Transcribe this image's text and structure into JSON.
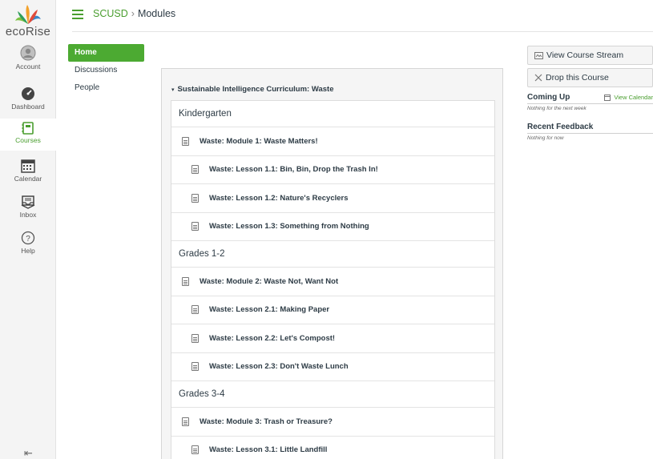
{
  "brand": {
    "logo_text": "ecoRise",
    "accent": "#4caa32"
  },
  "global_nav": [
    {
      "label": "Account",
      "icon": "account-icon"
    },
    {
      "label": "Dashboard",
      "icon": "dashboard-icon"
    },
    {
      "label": "Courses",
      "icon": "courses-icon",
      "active": true
    },
    {
      "label": "Calendar",
      "icon": "calendar-icon"
    },
    {
      "label": "Inbox",
      "icon": "inbox-icon"
    },
    {
      "label": "Help",
      "icon": "help-icon"
    }
  ],
  "collapse_icon": "⇤",
  "breadcrumb": {
    "course": "SCUSD",
    "separator": "›",
    "page": "Modules"
  },
  "course_nav": [
    {
      "label": "Home",
      "active": true
    },
    {
      "label": "Discussions"
    },
    {
      "label": "People"
    }
  ],
  "module": {
    "caret": "▾",
    "title": "Sustainable Intelligence Curriculum: Waste",
    "rows": [
      {
        "type": "header",
        "text": "Kindergarten"
      },
      {
        "type": "item",
        "level": 0,
        "text": "Waste: Module 1: Waste Matters!"
      },
      {
        "type": "item",
        "level": 1,
        "text": "Waste: Lesson 1.1: Bin, Bin, Drop the Trash In!"
      },
      {
        "type": "item",
        "level": 1,
        "text": "Waste: Lesson 1.2: Nature's Recyclers"
      },
      {
        "type": "item",
        "level": 1,
        "text": "Waste: Lesson 1.3: Something from Nothing"
      },
      {
        "type": "header",
        "text": "Grades 1-2"
      },
      {
        "type": "item",
        "level": 0,
        "text": "Waste: Module 2: Waste Not, Want Not"
      },
      {
        "type": "item",
        "level": 1,
        "text": "Waste: Lesson 2.1: Making Paper"
      },
      {
        "type": "item",
        "level": 1,
        "text": "Waste: Lesson 2.2: Let's Compost!"
      },
      {
        "type": "item",
        "level": 1,
        "text": "Waste: Lesson 2.3: Don't Waste Lunch"
      },
      {
        "type": "header",
        "text": "Grades 3-4"
      },
      {
        "type": "item",
        "level": 0,
        "text": "Waste: Module 3: Trash or Treasure?"
      },
      {
        "type": "item",
        "level": 1,
        "text": "Waste: Lesson 3.1: Little Landfill"
      }
    ]
  },
  "sidebar": {
    "view_stream": "View Course Stream",
    "drop_course": "Drop this Course",
    "coming_up": "Coming Up",
    "view_calendar": "View Calendar",
    "coming_up_note": "Nothing for the next week",
    "recent_feedback": "Recent Feedback",
    "recent_feedback_note": "Nothing for now"
  }
}
